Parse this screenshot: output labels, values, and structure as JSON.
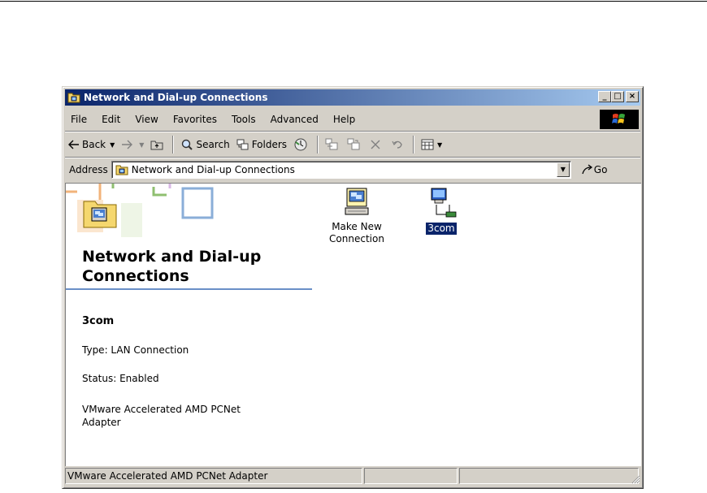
{
  "window": {
    "title": "Network and Dial-up Connections"
  },
  "caption_buttons": {
    "minimize": "_",
    "maximize": "□",
    "close": "×"
  },
  "menubar": {
    "items": [
      "File",
      "Edit",
      "View",
      "Favorites",
      "Tools",
      "Advanced",
      "Help"
    ]
  },
  "toolbar": {
    "back": "Back",
    "search": "Search",
    "folders": "Folders"
  },
  "address": {
    "label": "Address",
    "value": "Network and Dial-up Connections",
    "go": "Go"
  },
  "left_panel": {
    "heading_line1": "Network and Dial-up",
    "heading_line2": "Connections",
    "selected_name": "3com",
    "type": "Type: LAN Connection",
    "status": "Status: Enabled",
    "adapter_line1": "VMware Accelerated AMD PCNet",
    "adapter_line2": "Adapter"
  },
  "icons": [
    {
      "line1": "Make New",
      "line2": "Connection",
      "icon": "make-new-connection-icon"
    },
    {
      "line1": "3com",
      "icon": "lan-connection-icon",
      "selected": true
    }
  ],
  "statusbar": {
    "text": "VMware Accelerated AMD PCNet Adapter"
  },
  "colors": {
    "titlebar_start": "#0a246a",
    "titlebar_end": "#a6caf0",
    "face": "#d4d0c8",
    "selection": "#0a246a"
  }
}
